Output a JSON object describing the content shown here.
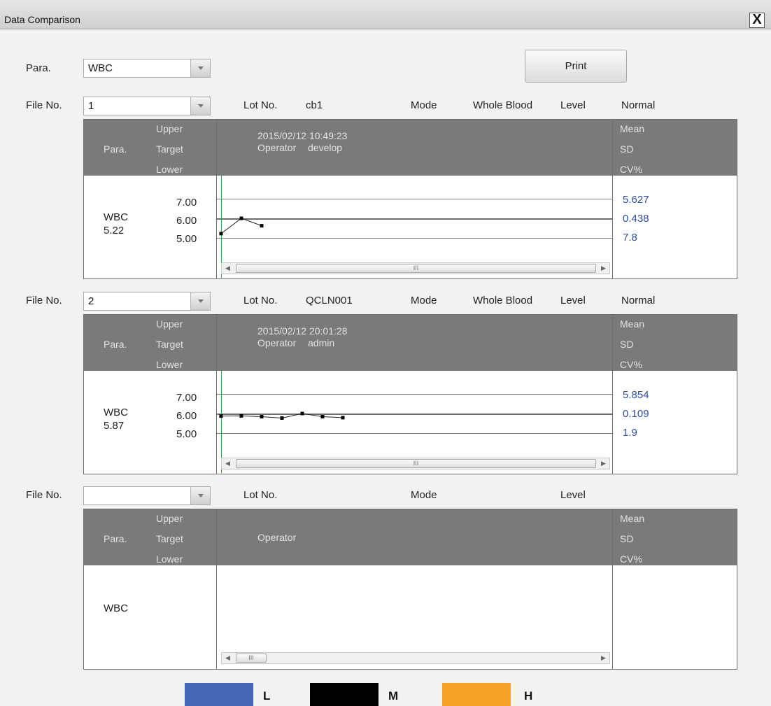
{
  "window": {
    "title": "Data Comparison",
    "close_glyph": "X"
  },
  "top": {
    "para_label": "Para.",
    "para_value": "WBC",
    "print_label": "Print"
  },
  "panels": [
    {
      "file_label": "File No.",
      "file_value": "1",
      "lot_label": "Lot No.",
      "lot_value": "cb1",
      "mode_label": "Mode",
      "mode_value": "Whole Blood",
      "level_label": "Level",
      "level_value": "Normal",
      "head": {
        "para": "Para.",
        "upper": "Upper",
        "target": "Target",
        "lower": "Lower",
        "datetime": "2015/02/12 10:49:23",
        "operator_label": "Operator",
        "operator_value": "develop",
        "mean": "Mean",
        "sd": "SD",
        "cv": "CV%"
      },
      "param_name": "WBC",
      "param_value": "5.22",
      "upper": "7.00",
      "target": "6.00",
      "lower": "5.00",
      "mean_value": "5.627",
      "sd_value": "0.438",
      "cv_value": "7.8",
      "scroll_mark": "III",
      "chart_data": {
        "type": "line",
        "ylim": [
          4.8,
          7.25
        ],
        "values": [
          5.22,
          6.0,
          5.62
        ]
      }
    },
    {
      "file_label": "File No.",
      "file_value": "2",
      "lot_label": "Lot No.",
      "lot_value": "QCLN001",
      "mode_label": "Mode",
      "mode_value": "Whole Blood",
      "level_label": "Level",
      "level_value": "Normal",
      "head": {
        "para": "Para.",
        "upper": "Upper",
        "target": "Target",
        "lower": "Lower",
        "datetime": "2015/02/12 20:01:28",
        "operator_label": "Operator",
        "operator_value": "admin",
        "mean": "Mean",
        "sd": "SD",
        "cv": "CV%"
      },
      "param_name": "WBC",
      "param_value": "5.87",
      "upper": "7.00",
      "target": "6.00",
      "lower": "5.00",
      "mean_value": "5.854",
      "sd_value": "0.109",
      "cv_value": "1.9",
      "scroll_mark": "III",
      "chart_data": {
        "type": "line",
        "ylim": [
          4.8,
          7.25
        ],
        "values": [
          5.87,
          5.88,
          5.84,
          5.77,
          6.0,
          5.84,
          5.79
        ]
      }
    },
    {
      "file_label": "File No.",
      "file_value": "",
      "lot_label": "Lot No.",
      "mode_label": "Mode",
      "level_label": "Level",
      "head": {
        "para": "Para.",
        "upper": "Upper",
        "target": "Target",
        "lower": "Lower",
        "operator_label": "Operator",
        "mean": "Mean",
        "sd": "SD",
        "cv": "CV%"
      },
      "param_name": "WBC",
      "scroll_mark": "III"
    }
  ],
  "legend": [
    {
      "label": "L",
      "color": "#4466b4"
    },
    {
      "label": "M",
      "color": "#000000"
    },
    {
      "label": "H",
      "color": "#f4a326"
    }
  ]
}
